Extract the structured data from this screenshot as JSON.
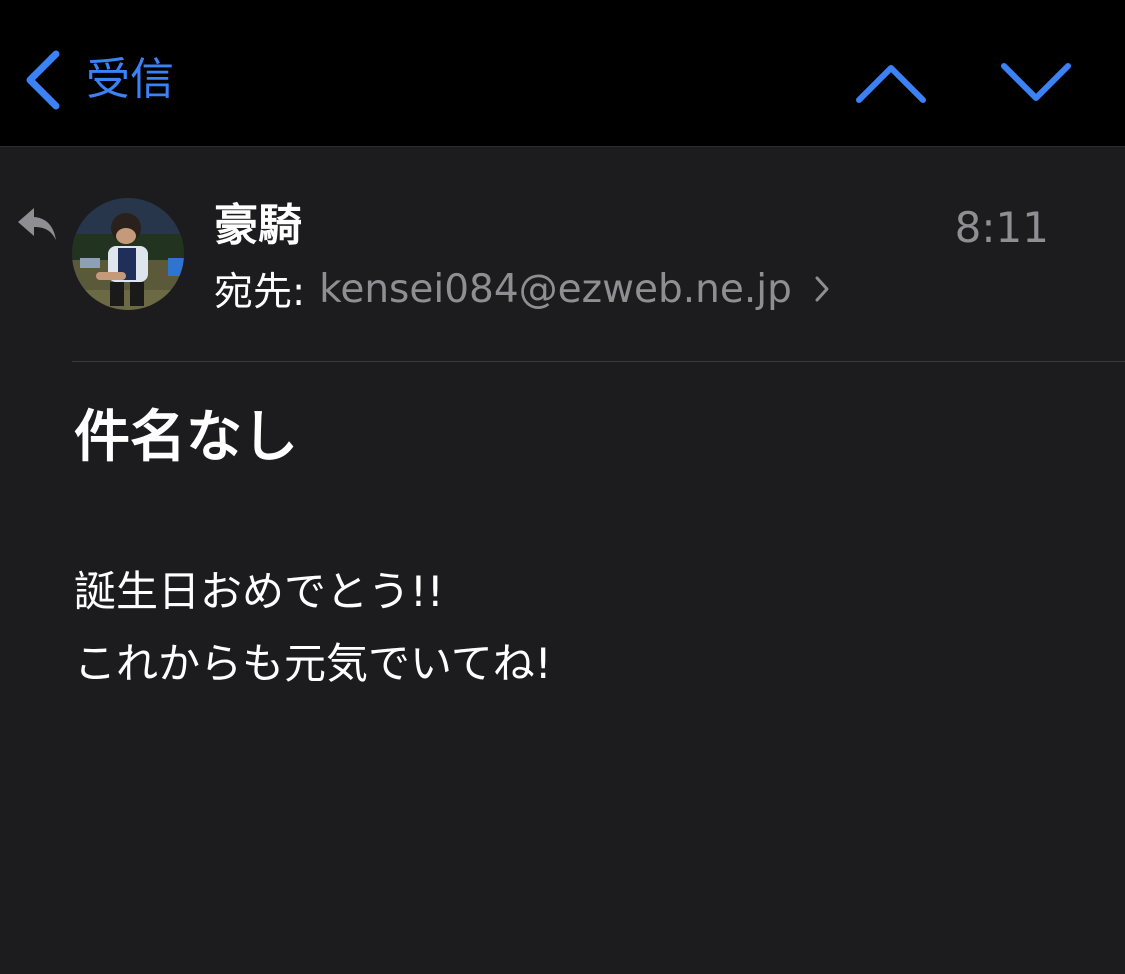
{
  "nav": {
    "back_label": "受信",
    "accent_color": "#3a82f6",
    "icons": {
      "back": "chevron-left-icon",
      "prev": "chevron-up-icon",
      "next": "chevron-down-icon"
    }
  },
  "message": {
    "sender_name": "豪騎",
    "time": "8:11",
    "recipient_label": "宛先:",
    "recipient_address": "kensei084@ezweb.ne.jp",
    "subject": "件名なし",
    "body_lines": [
      "誕生日おめでとう!!",
      "これからも元気でいてね!"
    ],
    "status_icon": "replied-arrow-icon"
  }
}
